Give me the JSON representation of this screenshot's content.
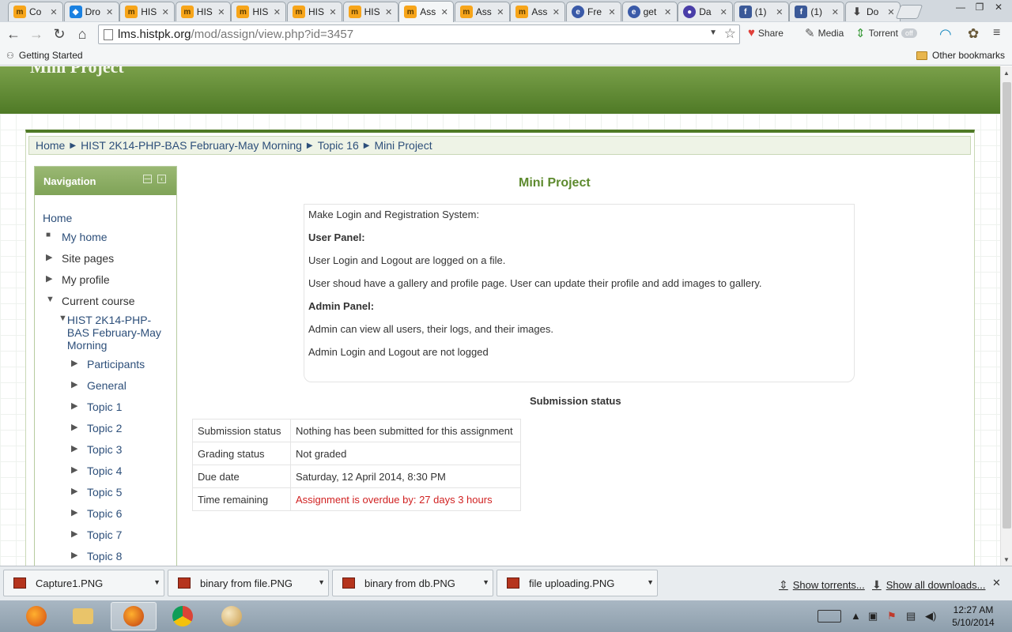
{
  "tabs": [
    {
      "title": "Co",
      "favicon": "moodle-icon"
    },
    {
      "title": "Dro",
      "favicon": "dropbox-icon"
    },
    {
      "title": "HIS",
      "favicon": "moodle-icon"
    },
    {
      "title": "HIS",
      "favicon": "moodle-icon"
    },
    {
      "title": "HIS",
      "favicon": "moodle-icon"
    },
    {
      "title": "HIS",
      "favicon": "moodle-icon"
    },
    {
      "title": "HIS",
      "favicon": "moodle-icon"
    },
    {
      "title": "Ass",
      "favicon": "moodle-icon",
      "active": true
    },
    {
      "title": "Ass",
      "favicon": "moodle-icon"
    },
    {
      "title": "Ass",
      "favicon": "moodle-icon"
    },
    {
      "title": "Fre",
      "favicon": "globe-icon"
    },
    {
      "title": "get",
      "favicon": "globe-icon"
    },
    {
      "title": "Da",
      "favicon": "circle-icon"
    },
    {
      "title": "(1)",
      "favicon": "facebook-icon"
    },
    {
      "title": "(1)",
      "favicon": "facebook-icon"
    },
    {
      "title": "Do",
      "favicon": "download-icon"
    }
  ],
  "toolbar": {
    "url_host": "lms.histpk.org",
    "url_path": "/mod/assign/view.php?id=3457",
    "share_label": "Share",
    "media_label": "Media",
    "torrent_label": "Torrent",
    "torrent_toggle": "off"
  },
  "bookmarks": {
    "getting_started": "Getting Started",
    "other": "Other bookmarks"
  },
  "site": {
    "banner_title": "Mini Project"
  },
  "breadcrumb": [
    "Home",
    "HIST 2K14-PHP-BAS February-May Morning",
    "Topic 16",
    "Mini Project"
  ],
  "navigation": {
    "title": "Navigation",
    "home": "Home",
    "my_home": "My home",
    "site_pages": "Site pages",
    "my_profile": "My profile",
    "current_course": "Current course",
    "course_name": "HIST 2K14-PHP-BAS February-May Morning",
    "course_items": [
      "Participants",
      "General",
      "Topic 1",
      "Topic 2",
      "Topic 3",
      "Topic 4",
      "Topic 5",
      "Topic 6",
      "Topic 7",
      "Topic 8"
    ]
  },
  "assignment": {
    "title": "Mini Project",
    "intro": [
      {
        "text": "Make Login and Registration System:",
        "heading": false
      },
      {
        "text": "User Panel:",
        "heading": true
      },
      {
        "text": "User Login and Logout are logged on a file.",
        "heading": false
      },
      {
        "text": "User shoud have a gallery and profile page. User can update their profile and add images to gallery.",
        "heading": false
      },
      {
        "text": "Admin Panel:",
        "heading": true
      },
      {
        "text": "Admin can view all users, their logs, and their images.",
        "heading": false
      },
      {
        "text": "Admin Login and Logout are not logged",
        "heading": false
      }
    ],
    "submission_heading": "Submission status",
    "status_rows": [
      {
        "label": "Submission status",
        "value": "Nothing has been submitted for this assignment"
      },
      {
        "label": "Grading status",
        "value": "Not graded"
      },
      {
        "label": "Due date",
        "value": "Saturday, 12 April 2014, 8:30 PM"
      },
      {
        "label": "Time remaining",
        "value": "Assignment is overdue by: 27 days 3 hours",
        "overdue": true
      }
    ]
  },
  "downloads": {
    "items": [
      "Capture1.PNG",
      "binary from file.PNG",
      "binary from db.PNG",
      "file uploading.PNG"
    ],
    "show_torrents": "Show torrents...",
    "show_all": "Show all downloads..."
  },
  "taskbar": {
    "time": "12:27 AM",
    "date": "5/10/2014"
  },
  "colors": {
    "banner": "#5f8a33",
    "accent_green": "#5d8a2e",
    "link": "#2d4f7a",
    "overdue": "#d12222"
  }
}
